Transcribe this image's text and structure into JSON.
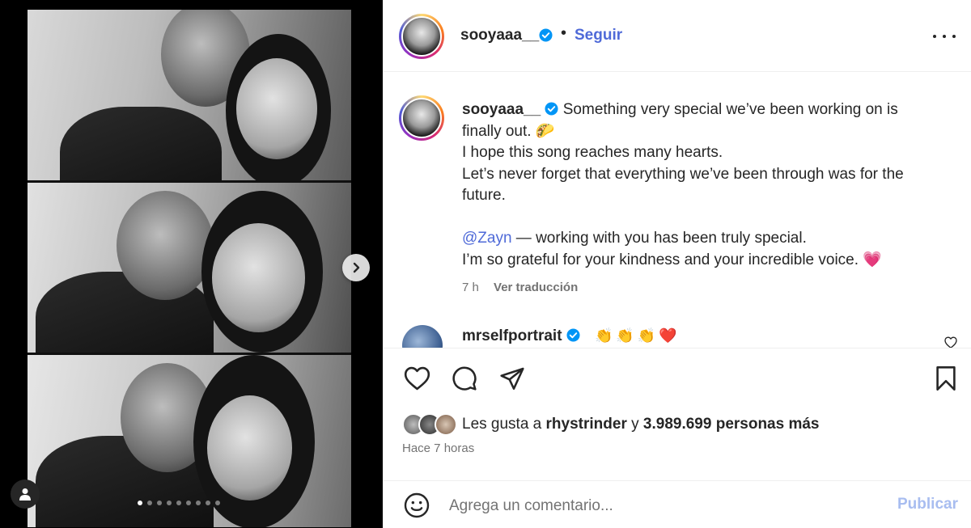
{
  "post": {
    "username": "sooyaaa__",
    "verified": true,
    "separator": "•",
    "follow_label": "Seguir",
    "caption_lines": [
      "Something very special we’ve been working on is",
      "finally out. 🌮",
      "I hope this song reaches many hearts.",
      "Let’s never forget that everything we’ve been through was for the",
      "future."
    ],
    "mention": "@Zayn",
    "mention_rest": " — working with you has been truly special.",
    "closing_line": "I’m so grateful for your kindness and your incredible voice. 💗",
    "caption_age": "7 h",
    "translate_label": "Ver traducción"
  },
  "comment": {
    "username": "mrselfportrait",
    "text": "👏👏👏❤️"
  },
  "carousel": {
    "slide_count": 9,
    "active_index": 0
  },
  "likes": {
    "prefix": "Les gusta a ",
    "user": "rhystrinder",
    "middle": " y ",
    "count": "3.989.699 personas más"
  },
  "timestamp": "Hace 7 horas",
  "composer": {
    "placeholder": "Agrega un comentario...",
    "post_label": "Publicar"
  },
  "colors": {
    "link": "#4f6ad8",
    "heart": "#ff3040",
    "muted": "#737373"
  }
}
